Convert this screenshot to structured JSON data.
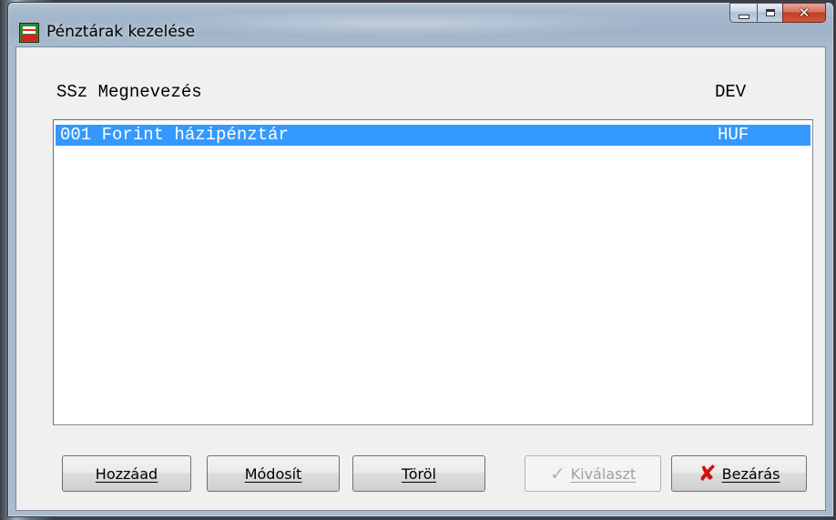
{
  "window": {
    "title": "Pénztárak kezelése",
    "icon": "cash-register-app-icon",
    "caption_buttons": [
      "minimize",
      "maximize",
      "close"
    ]
  },
  "list": {
    "header_left": "SSz Megnevezés",
    "header_right": "DEV",
    "rows": [
      {
        "left": "001 Forint házipénztár",
        "right": "HUF",
        "selected": true
      }
    ]
  },
  "buttons": {
    "add": "Hozzáad",
    "modify": "Módosít",
    "delete": "Töröl",
    "select": "Kiválaszt",
    "close": "Bezárás"
  },
  "colors": {
    "selection": "#3399ff",
    "close_icon": "#d01010"
  }
}
